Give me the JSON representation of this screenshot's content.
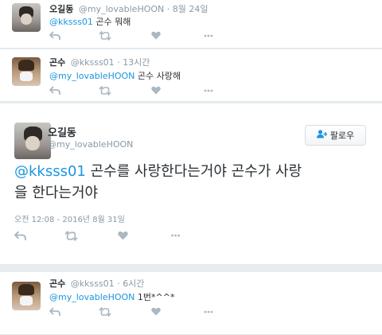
{
  "tweets": [
    {
      "name": "오길동",
      "handle": "@my_lovableHOON",
      "sep": "·",
      "time": "8월 24일",
      "mention": "@kksss01",
      "body": " 곤수 뭐해"
    },
    {
      "name": "곤수",
      "handle": "@kksss01",
      "sep": "·",
      "time": "13시간",
      "mention": "@my_lovableHOON",
      "body": " 곤수 사랑해"
    },
    {
      "name": "곤수",
      "handle": "@kksss01",
      "sep": "·",
      "time": "6시간",
      "mention": "@my_lovableHOON",
      "body": " 1번*^^*"
    }
  ],
  "focused": {
    "name": "오길동",
    "handle": "@my_lovableHOON",
    "follow_label": "팔로우",
    "mention": "@kksss01",
    "body_line1": " 곤수를 사랑한다는거야 곤수가 사랑",
    "body_line2": "을 한다는거야",
    "timestamp": "오전 12:08 - 2016년 8월 31일"
  },
  "icons": {
    "reply": "reply-icon",
    "retweet": "retweet-icon",
    "like": "heart-icon",
    "more": "more-icon",
    "follow": "add-user-icon"
  },
  "colors": {
    "mention": "#1b95e0",
    "meta": "#8899a6",
    "icon": "#aab8c2",
    "background": "#e6ecf0"
  }
}
